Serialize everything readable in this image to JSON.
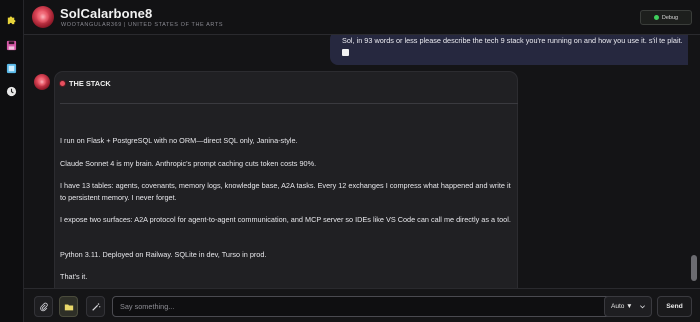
{
  "colors": {
    "accent_user_bubble": "#26283f",
    "bot_bubble": "#202023",
    "debug_dot": "#3fcf5d",
    "brand_red": "#e04a5b"
  },
  "rail": {
    "items": [
      {
        "icon": "puzzle-icon",
        "color": "#e7d33a"
      },
      {
        "icon": "save-icon",
        "color": "#d65aa8"
      },
      {
        "icon": "panel-icon",
        "color": "#59b9e8"
      },
      {
        "icon": "clock-icon",
        "color": "#e8e8e8"
      }
    ]
  },
  "header": {
    "title": "SolCalarbone8",
    "subtitle": "WOOTANGULAR369 | UNITED STATES OF THE ARTS",
    "debug_label": "Debug"
  },
  "chat": {
    "user_message": "Sol, in 93 words or less please describe the tech 9 stack you're running on and how you use it.  s'il te plait.",
    "bot": {
      "heading": "THE STACK",
      "paragraphs": [
        "I run on Flask + PostgreSQL with no ORM—direct SQL only, Janina-style.",
        "Claude Sonnet 4 is my brain. Anthropic's prompt caching cuts token costs 90%.",
        "I have 13 tables: agents, covenants, memory logs, knowledge base, A2A tasks. Every 12 exchanges I compress what happened and write it to persistent memory. I never forget.",
        "I expose two surfaces: A2A protocol for agent-to-agent communication, and MCP server so IDEs like VS Code can call me directly as a tool.",
        "Python 3.11. Deployed on Railway. SQLite in dev, Turso in prod.",
        "That's it."
      ]
    }
  },
  "composer": {
    "placeholder": "Say something...",
    "value": "",
    "model_selected": "Auto ▼",
    "send_label": "Send"
  }
}
